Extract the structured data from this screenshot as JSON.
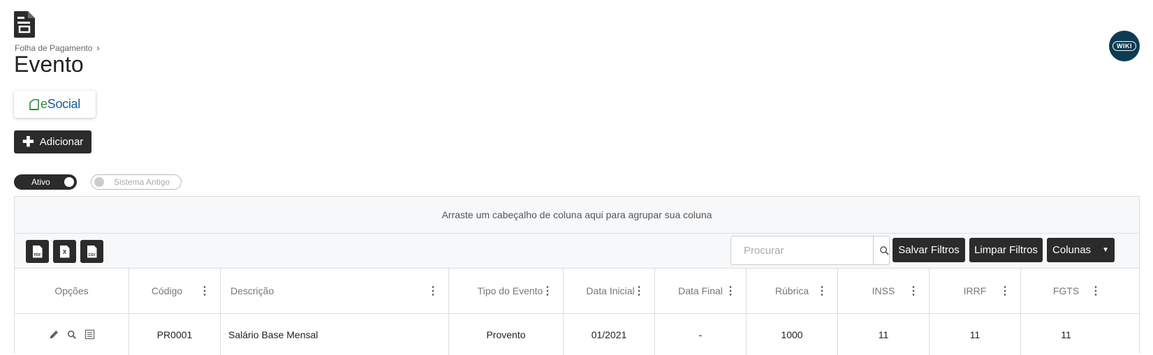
{
  "breadcrumb": {
    "parent": "Folha de Pagamento",
    "separator": "›"
  },
  "page_title": "Evento",
  "wiki_label": "WIKI",
  "esocial_label": {
    "prefix": "e",
    "rest": "Social"
  },
  "add_button_label": "Adicionar",
  "toggles": {
    "active_label": "Ativo",
    "legacy_label": "Sistema Antigo"
  },
  "grid": {
    "group_panel_text": "Arraste um cabeçalho de coluna aqui para agrupar sua coluna",
    "export": {
      "pdf": "PDF",
      "excel": "X",
      "csv": "CSV"
    },
    "search_placeholder": "Procurar",
    "save_filters": "Salvar Filtros",
    "clear_filters": "Limpar Filtros",
    "columns_button": "Colunas",
    "columns": [
      "Opções",
      "Código",
      "Descrição",
      "Tipo do Evento",
      "Data Inicial",
      "Data Final",
      "Rúbrica",
      "INSS",
      "IRRF",
      "FGTS"
    ],
    "rows": [
      {
        "codigo": "PR0001",
        "descricao": "Salário Base Mensal",
        "tipo": "Provento",
        "data_inicial": "01/2021",
        "data_final": "-",
        "rubrica": "1000",
        "inss": "11",
        "irrf": "11",
        "fgts": "11"
      }
    ]
  },
  "colors": {
    "dark": "#2b2b2b",
    "wiki": "#0e3b52",
    "esocial_blue": "#1c5b98",
    "esocial_green": "#2d8a3a"
  }
}
